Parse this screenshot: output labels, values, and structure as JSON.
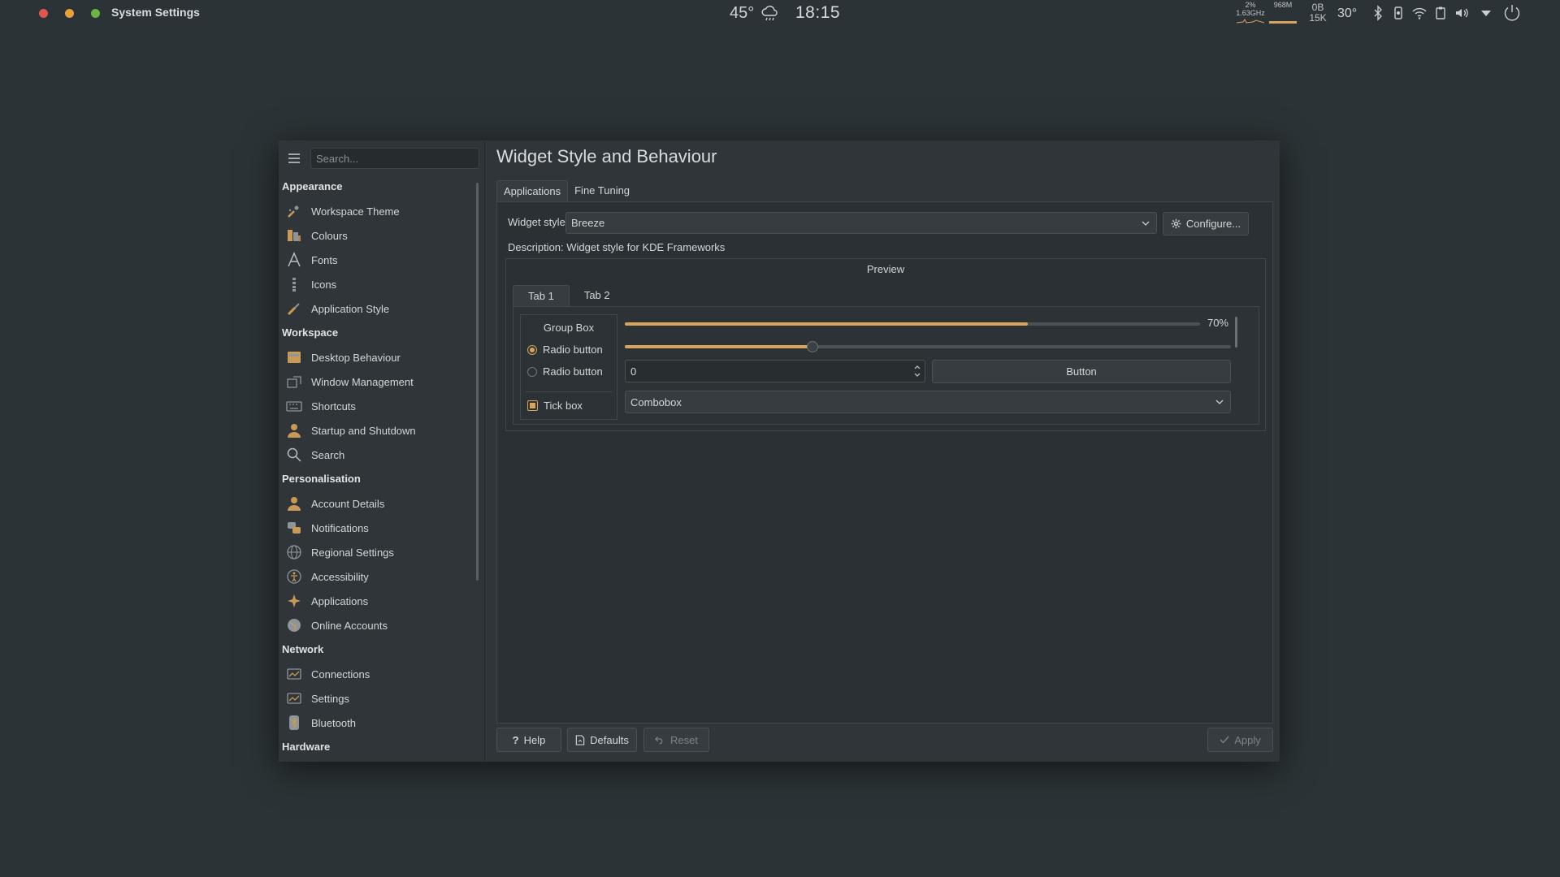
{
  "topbar": {
    "app_title": "System Settings",
    "weather_temp": "45°",
    "weather_icon": "cloud-rain-icon",
    "clock": "18:15",
    "cpu_percent": "2%",
    "cpu_freq": "1.63GHz",
    "memory": "968M",
    "net_up": "0B",
    "net_down": "15K",
    "cpu_temp": "30°",
    "colors": {
      "close": "#e0554d",
      "minimize": "#e8a13a",
      "maximize": "#6cb443"
    }
  },
  "sidebar": {
    "search_placeholder": "Search...",
    "sections": {
      "appearance": {
        "label": "Appearance",
        "items": [
          "Workspace Theme",
          "Colours",
          "Fonts",
          "Icons",
          "Application Style"
        ]
      },
      "workspace": {
        "label": "Workspace",
        "items": [
          "Desktop Behaviour",
          "Window Management",
          "Shortcuts",
          "Startup and Shutdown",
          "Search"
        ]
      },
      "personalisation": {
        "label": "Personalisation",
        "items": [
          "Account Details",
          "Notifications",
          "Regional Settings",
          "Accessibility",
          "Applications",
          "Online Accounts"
        ]
      },
      "network": {
        "label": "Network",
        "items": [
          "Connections",
          "Settings",
          "Bluetooth"
        ]
      },
      "hardware": {
        "label": "Hardware"
      }
    }
  },
  "main": {
    "title": "Widget Style and Behaviour",
    "tabs": [
      "Applications",
      "Fine Tuning"
    ],
    "widget_style_label": "Widget style:",
    "widget_style_value": "Breeze",
    "configure_label": "Configure...",
    "description": "Description: Widget style for KDE Frameworks",
    "preview": {
      "title": "Preview",
      "tabs": [
        "Tab 1",
        "Tab 2"
      ],
      "group_box_title": "Group Box",
      "radio1": "Radio button",
      "radio2": "Radio button",
      "tick_box": "Tick box",
      "progress_percent_text": "70%",
      "progress_value": 0.7,
      "slider_value": 0.31,
      "spin_value": "0",
      "button_label": "Button",
      "combobox_value": "Combobox"
    }
  },
  "footer": {
    "help": "Help",
    "defaults": "Defaults",
    "reset": "Reset",
    "apply": "Apply"
  },
  "accent_color": "#d9a45b"
}
